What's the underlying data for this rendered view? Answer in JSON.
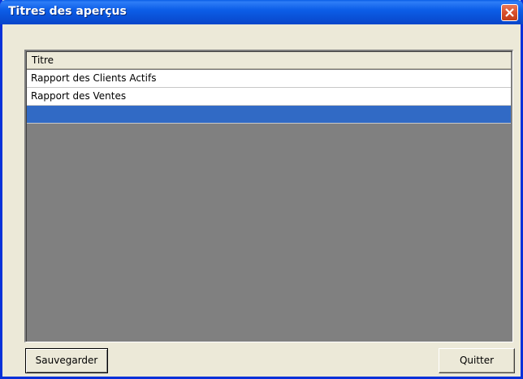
{
  "window": {
    "title": "Titres des aperçus"
  },
  "list": {
    "column_header": "Titre",
    "rows": [
      {
        "label": "Rapport des Clients Actifs",
        "selected": false
      },
      {
        "label": "Rapport des Ventes",
        "selected": false
      },
      {
        "label": "",
        "selected": true
      }
    ]
  },
  "buttons": {
    "save_label": "Sauvegarder",
    "quit_label": "Quitter"
  },
  "icons": {
    "close": "close-icon"
  },
  "colors": {
    "titlebar": "#0a52d8",
    "selection": "#316ac5",
    "list_background": "#808080",
    "dialog_background": "#ece9d8"
  }
}
